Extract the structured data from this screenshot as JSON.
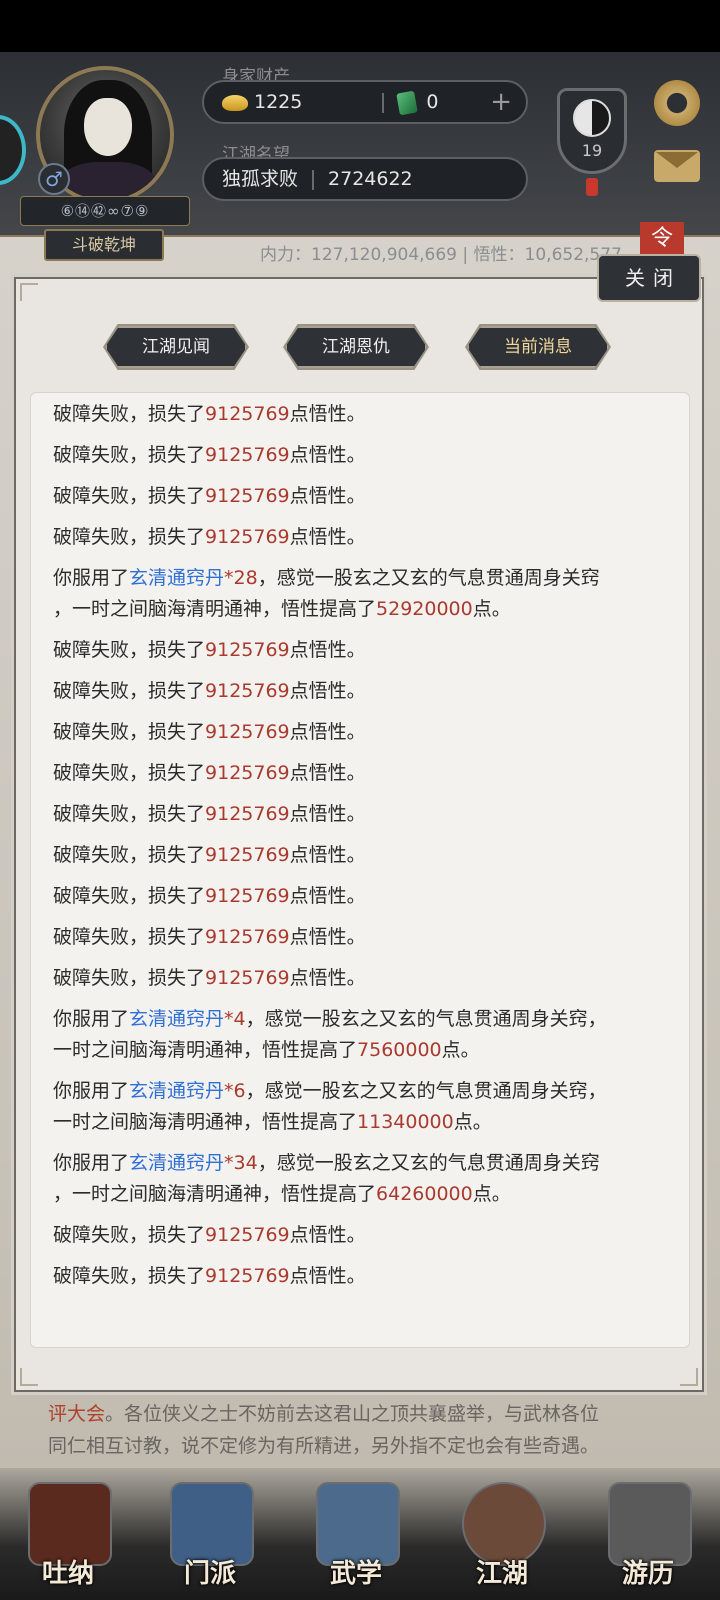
{
  "header": {
    "wealth_label": "身家财产",
    "gold": "1225",
    "jade": "0",
    "plus": "+",
    "fame_label": "江湖名望",
    "fame_title": "独孤求败",
    "fame_value": "2724622",
    "rank_code": "⑥⑭㊷∞⑦⑨",
    "gender_symbol": "♂",
    "title_plaque": "斗破乾坤",
    "taiji_level": "19",
    "stats": "内力：127,120,904,669  |  悟性：10,652,577",
    "corner_badge": "令"
  },
  "dialog": {
    "close_label": "关闭",
    "tabs": [
      {
        "label": "江湖见闻"
      },
      {
        "label": "江湖恩仇"
      },
      {
        "label": "当前消息"
      }
    ],
    "fail_prefix": "破障失败，损失了",
    "fail_amount": "9125769",
    "fail_suffix": "点悟性。",
    "take_prefix": "你服用了",
    "item_name": "玄清通窍丹",
    "take_mid": "，感觉一股玄之又玄的气息贯通周身关窍",
    "take_mid2": "，一时之间脑海清明通神，悟性提高了",
    "take_suffix": "点。",
    "pill_messages": [
      {
        "count": "*28",
        "gain": "52920000"
      },
      {
        "count": "*4",
        "gain": "7560000"
      },
      {
        "count": "*6",
        "gain": "11340000"
      },
      {
        "count": "*34",
        "gain": "64260000"
      }
    ]
  },
  "under_text": {
    "line1_red": "评大会",
    "line1_rest": "。各位侠义之士不妨前去这君山之顶共襄盛举，与武林各位",
    "line2": "同仁相互讨教，说不定修为有所精进，另外指不定也会有些奇遇。"
  },
  "nav": [
    {
      "label": "吐纳"
    },
    {
      "label": "门派"
    },
    {
      "label": "武学"
    },
    {
      "label": "江湖"
    },
    {
      "label": "游历"
    }
  ]
}
